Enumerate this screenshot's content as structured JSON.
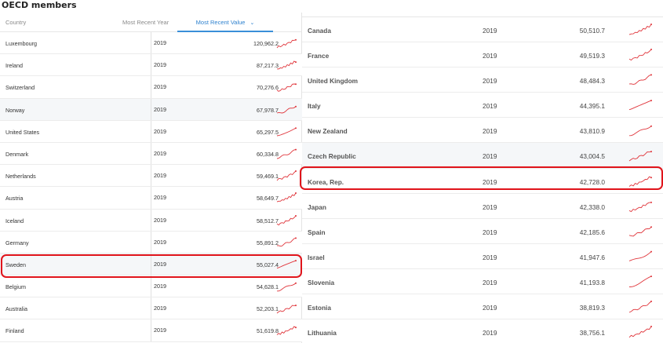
{
  "page": {
    "title": "OECD members"
  },
  "left_table": {
    "headers": {
      "country": "Country",
      "year": "Most Recent Year",
      "value": "Most Recent Value",
      "sort_icon": "⌄"
    },
    "rows": [
      {
        "country": "Luxembourg",
        "year": "2019",
        "value": "120,962.2"
      },
      {
        "country": "Ireland",
        "year": "2019",
        "value": "87,217.3"
      },
      {
        "country": "Switzerland",
        "year": "2019",
        "value": "70,276.6"
      },
      {
        "country": "Norway",
        "year": "2019",
        "value": "67,978.7"
      },
      {
        "country": "United States",
        "year": "2019",
        "value": "65,297.5"
      },
      {
        "country": "Denmark",
        "year": "2019",
        "value": "60,334.8"
      },
      {
        "country": "Netherlands",
        "year": "2019",
        "value": "59,469.1"
      },
      {
        "country": "Austria",
        "year": "2019",
        "value": "58,649.7"
      },
      {
        "country": "Iceland",
        "year": "2019",
        "value": "58,512.7"
      },
      {
        "country": "Germany",
        "year": "2019",
        "value": "55,891.2"
      },
      {
        "country": "Sweden",
        "year": "2019",
        "value": "55,027.4"
      },
      {
        "country": "Belgium",
        "year": "2019",
        "value": "54,628.1"
      },
      {
        "country": "Australia",
        "year": "2019",
        "value": "52,203.1"
      },
      {
        "country": "Finland",
        "year": "2019",
        "value": "51,619.8"
      }
    ]
  },
  "right_table": {
    "rows": [
      {
        "country": "Canada",
        "year": "2019",
        "value": "50,510.7"
      },
      {
        "country": "France",
        "year": "2019",
        "value": "49,519.3"
      },
      {
        "country": "United Kingdom",
        "year": "2019",
        "value": "48,484.3"
      },
      {
        "country": "Italy",
        "year": "2019",
        "value": "44,395.1"
      },
      {
        "country": "New Zealand",
        "year": "2019",
        "value": "43,810.9"
      },
      {
        "country": "Czech Republic",
        "year": "2019",
        "value": "43,004.5"
      },
      {
        "country": "Korea, Rep.",
        "year": "2019",
        "value": "42,728.0"
      },
      {
        "country": "Japan",
        "year": "2019",
        "value": "42,338.0"
      },
      {
        "country": "Spain",
        "year": "2019",
        "value": "42,185.6"
      },
      {
        "country": "Israel",
        "year": "2019",
        "value": "41,947.6"
      },
      {
        "country": "Slovenia",
        "year": "2019",
        "value": "41,193.8"
      },
      {
        "country": "Estonia",
        "year": "2019",
        "value": "38,819.3"
      },
      {
        "country": "Lithuania",
        "year": "2019",
        "value": "38,756.1"
      }
    ]
  },
  "colors": {
    "sparkline": "#e0343a",
    "highlight": "#e0141b",
    "accent": "#2f82cf"
  },
  "icons": {
    "sparkline": "trend-sparkline-icon",
    "sort": "chevron-down-icon"
  }
}
